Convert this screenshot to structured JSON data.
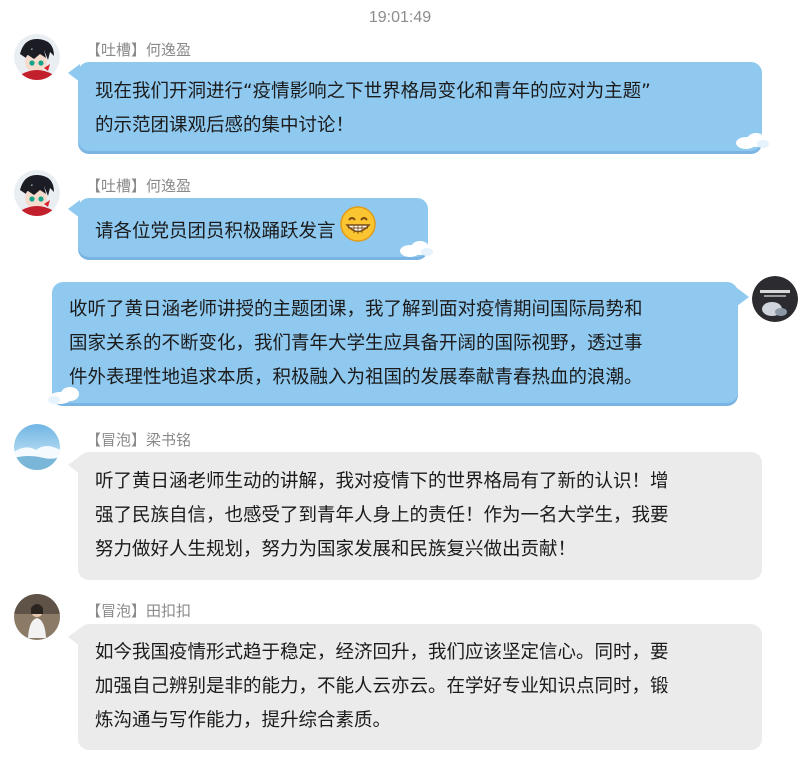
{
  "chat": {
    "timestamp": "19:01:49",
    "messages": [
      {
        "tag": "【吐槽】",
        "name": "何逸盈",
        "lines": [
          "现在我们开洞进行“疫情影响之下世界格局变化和青年的应对为主题”",
          "的示范团课观后感的集中讨论！"
        ],
        "style": "blue",
        "avatar": "anime-avatar-icon"
      },
      {
        "tag": "【吐槽】",
        "name": "何逸盈",
        "lines": [
          "请各位党员团员积极踊跃发言"
        ],
        "emoji": "grinning-face-icon",
        "style": "blue",
        "avatar": "anime-avatar-icon"
      },
      {
        "lines": [
          "收听了黄日涵老师讲授的主题团课，我了解到面对疫情期间国际局势和",
          "国家关系的不断变化，我们青年大学生应具备开阔的国际视野，透过事",
          "件外表理性地追求本质，积极融入为祖国的发展奉献青春热血的浪潮。"
        ],
        "style": "blue",
        "outgoing": true,
        "avatar": "self-avatar-icon"
      },
      {
        "tag": "【冒泡】",
        "name": "梁书铭",
        "lines": [
          "听了黄日涵老师生动的讲解，我对疫情下的世界格局有了新的认识！增",
          "强了民族自信，也感受了到青年人身上的责任！作为一名大学生，我要",
          "努力做好人生规划，努力为国家发展和民族复兴做出贡献！"
        ],
        "style": "gray",
        "avatar": "landscape-avatar-icon"
      },
      {
        "tag": "【冒泡】",
        "name": "田扣扣",
        "lines": [
          "如今我国疫情形式趋于稳定，经济回升，我们应该坚定信心。同时，要",
          "加强自己辨别是非的能力，不能人云亦云。在学好专业知识点同时，锻",
          "炼沟通与写作能力，提升综合素质。"
        ],
        "style": "gray",
        "avatar": "girl-photo-avatar-icon"
      }
    ]
  },
  "colors": {
    "blue_bubble": "#8fc9f0",
    "gray_bubble": "#ebebeb",
    "sender_text": "#8a8a8a",
    "timestamp_text": "#8c8c8c"
  }
}
